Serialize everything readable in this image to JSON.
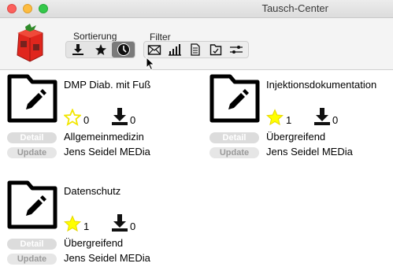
{
  "window": {
    "title": "Tausch-Center"
  },
  "toolbar": {
    "sort_label": "Sortierung",
    "filter_label": "Filter",
    "sort_buttons": [
      "download-sort-icon",
      "star-sort-icon",
      "clock-sort-icon"
    ],
    "sort_selected": "clock-sort-icon",
    "filter_buttons": [
      "mail-filter-icon",
      "chart-filter-icon",
      "document-filter-icon",
      "folder-check-filter-icon",
      "settings-filter-icon"
    ]
  },
  "cards": [
    {
      "title": "DMP Diab. mit Fuß",
      "stars": "0",
      "star_style": "outline",
      "downloads": "0",
      "category": "Allgemeinmedizin",
      "author": "Jens Seidel MEDia",
      "detail_label": "Detail",
      "update_label": "Update"
    },
    {
      "title": "Injektionsdokumentation",
      "stars": "1",
      "star_style": "filled",
      "downloads": "0",
      "category": "Übergreifend",
      "author": "Jens Seidel MEDia",
      "detail_label": "Detail",
      "update_label": "Update"
    },
    {
      "title": "Datenschutz",
      "stars": "1",
      "star_style": "filled",
      "downloads": "0",
      "category": "Übergreifend",
      "author": "Jens Seidel MEDia",
      "detail_label": "Detail",
      "update_label": "Update"
    }
  ],
  "colors": {
    "star_fill": "#ffff00",
    "star_outline": "#f2e600",
    "pill_bg": "#dcdcdc"
  }
}
